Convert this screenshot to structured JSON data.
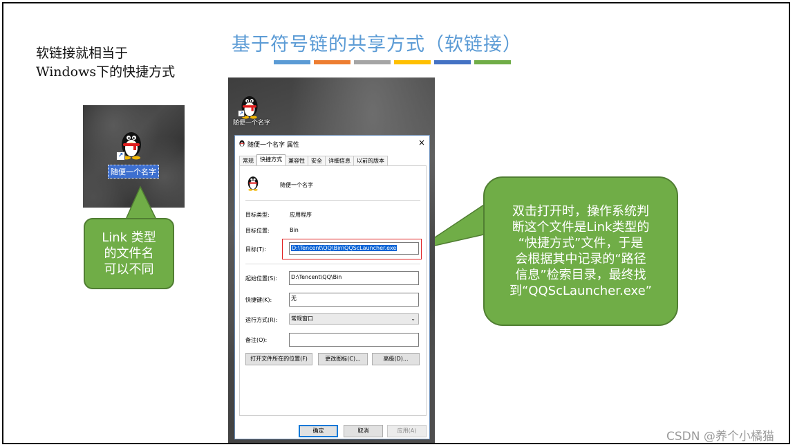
{
  "slide": {
    "note": "软链接就相当于\nWindows下的快捷方式",
    "title": "基于符号链的共享方式（软链接）",
    "title_bar_colors": [
      "#5b9bd5",
      "#ed7d31",
      "#a5a5a5",
      "#ffc000",
      "#4472c4",
      "#70ad47"
    ]
  },
  "small_desktop": {
    "icon": "qq-penguin-icon",
    "shortcut_icon": "shortcut-arrow-icon",
    "label": "随便一个名字"
  },
  "callouts": {
    "left": "Link 类型\n的文件名\n可以不同",
    "right": "双击打开时，操作系统判\n断这个文件是Link类型的\n“快捷方式”文件，于是\n会根据其中记录的“路径\n信息”检索目录，最终找\n到“QQScLauncher.exe”",
    "fill_color": "#70ad47"
  },
  "desktop": {
    "icon": "qq-penguin-icon",
    "label": "随便一个名字"
  },
  "dialog": {
    "title": "随便一个名字 属性",
    "close_glyph": "×",
    "tabs": [
      "常规",
      "快捷方式",
      "兼容性",
      "安全",
      "详细信息",
      "以前的版本"
    ],
    "active_tab": "快捷方式",
    "name": "随便一个名字",
    "target_type_label": "目标类型:",
    "target_type_value": "应用程序",
    "target_location_label": "目标位置:",
    "target_location_value": "Bin",
    "target_label": "目标(T):",
    "target_value": "D:\\Tencent\\QQ\\Bin\\QQScLauncher.exe",
    "start_in_label": "起始位置(S):",
    "start_in_value": "D:\\Tencent\\QQ\\Bin",
    "hotkey_label": "快捷键(K):",
    "hotkey_value": "无",
    "run_label": "运行方式(R):",
    "run_value": "常规窗口",
    "comment_label": "备注(O):",
    "comment_value": "",
    "open_location_button": "打开文件所在的位置(F)",
    "change_icon_button": "更改图标(C)...",
    "advanced_button": "高级(D)...",
    "ok_button": "确定",
    "cancel_button": "取消",
    "apply_button": "应用(A)"
  },
  "watermark": "CSDN @养个小橘猫"
}
